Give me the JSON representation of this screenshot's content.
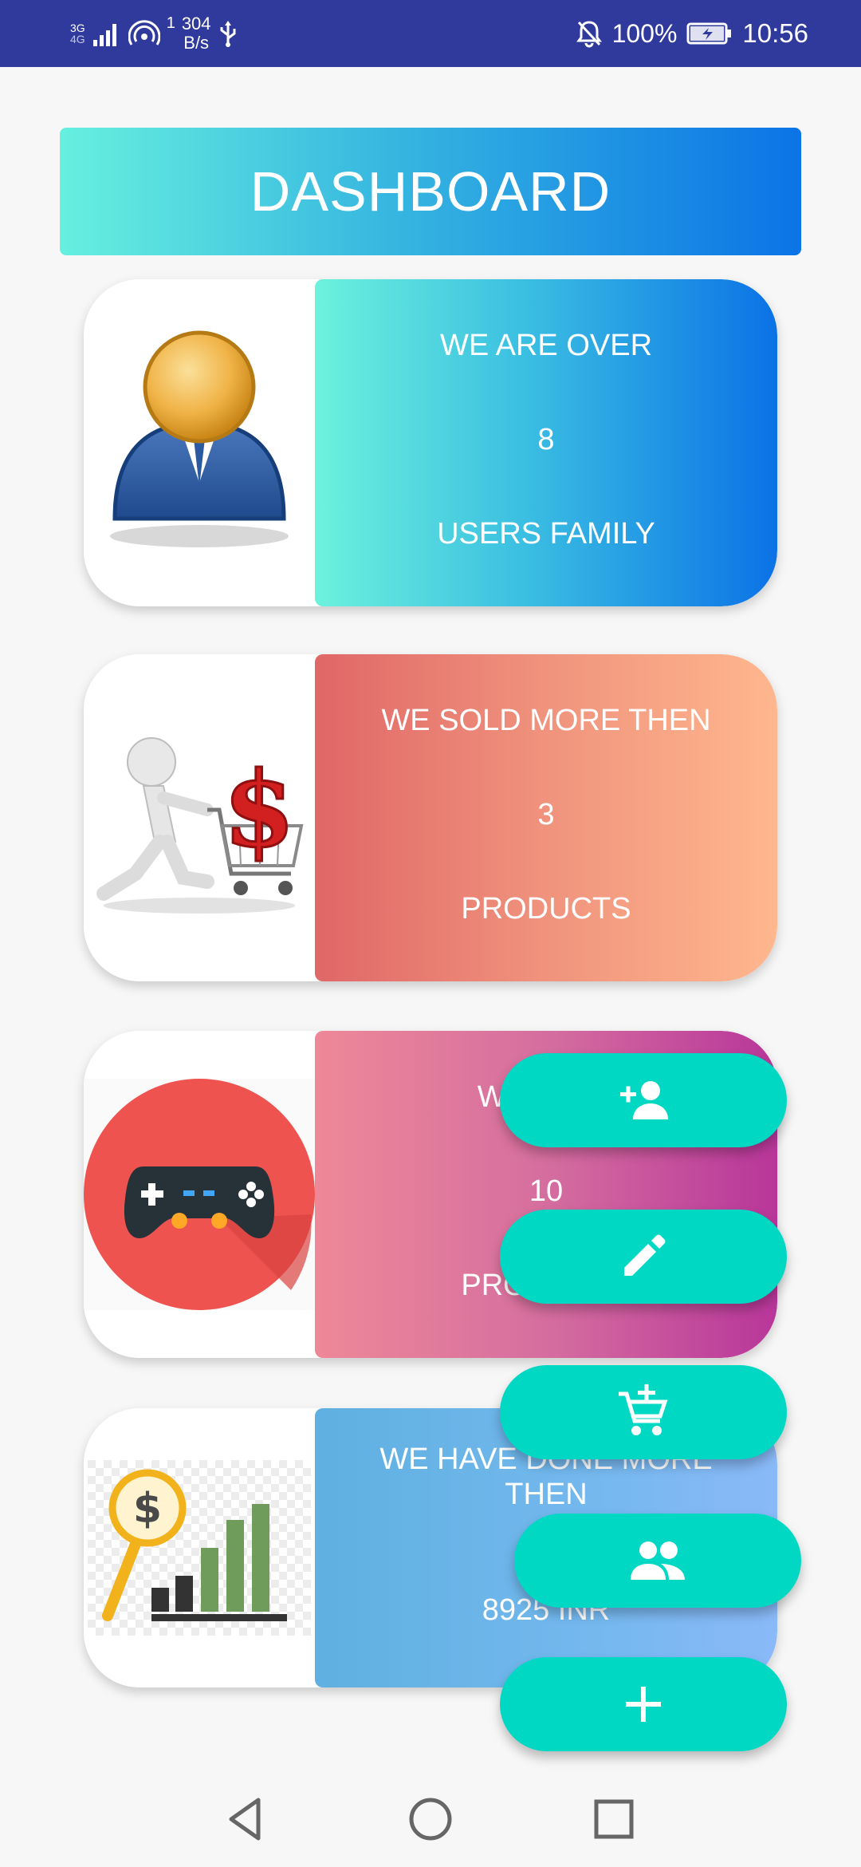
{
  "status_bar": {
    "network_type": "3G",
    "network_sub": "4G",
    "sim_index": "1",
    "speed_value": "304",
    "speed_unit": "B/s",
    "battery_percent": "100%",
    "time": "10:56"
  },
  "header": {
    "title": "DASHBOARD"
  },
  "cards": [
    {
      "line1": "WE ARE OVER",
      "number": "8",
      "line3": "USERS FAMILY",
      "image": "user-avatar-image"
    },
    {
      "line1": "WE SOLD MORE THEN",
      "number": "3",
      "line3": "PRODUCTS",
      "image": "shopping-cart-dollar-image"
    },
    {
      "line1": "WE HAVE",
      "number": "10",
      "line3": "PRODUCTS",
      "image": "gamepad-image"
    },
    {
      "line1": "WE HAVE DONE MORE THEN",
      "number": "8925 INR",
      "line3": "",
      "image": "revenue-chart-image"
    }
  ],
  "fabs": [
    {
      "icon": "add-user-icon"
    },
    {
      "icon": "edit-icon"
    },
    {
      "icon": "add-to-cart-icon"
    },
    {
      "icon": "users-icon"
    },
    {
      "icon": "plus-icon"
    }
  ],
  "colors": {
    "status_bar": "#2f3a9c",
    "fab": "#00d8c3",
    "background": "#f7f7f7"
  },
  "nav": {
    "back": "back-icon",
    "home": "home-icon",
    "recents": "recents-icon"
  }
}
